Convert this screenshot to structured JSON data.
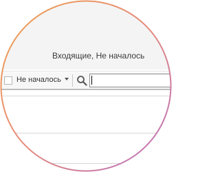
{
  "header": {
    "folder_title": "Входящие, Не началось"
  },
  "toolbar": {
    "filter_checkbox_checked": false,
    "filter_label": "Не началось",
    "filter_dropdown_icon": "chevron-down-icon",
    "search_icon": "search-icon",
    "search_value": "",
    "search_placeholder": ""
  },
  "list": {
    "rows": [
      {
        "text": ""
      },
      {
        "text": ""
      },
      {
        "text": ""
      }
    ]
  },
  "colors": {
    "ring_gradient_start": "#f0a04a",
    "ring_gradient_mid": "#e58a7a",
    "ring_gradient_end": "#b86fc4"
  }
}
